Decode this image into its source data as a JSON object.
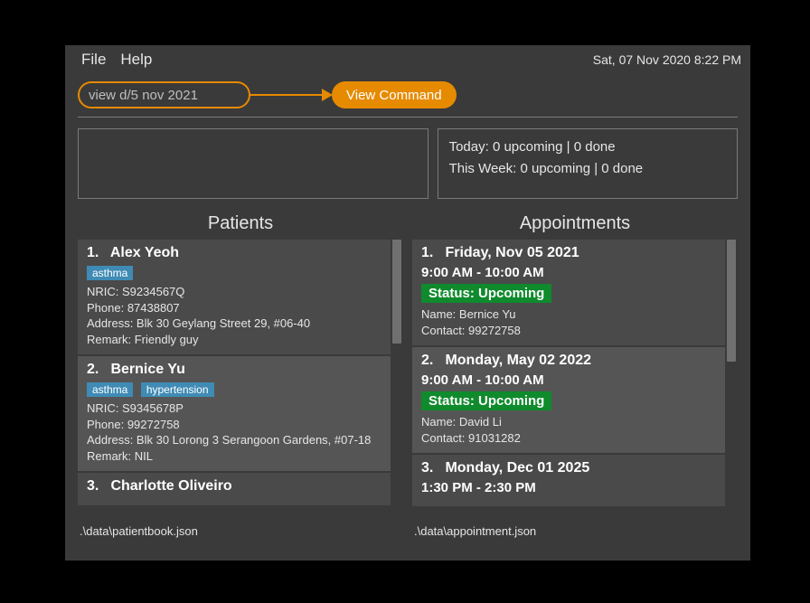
{
  "menu": {
    "file": "File",
    "help": "Help"
  },
  "datetime": "Sat, 07 Nov 2020 8:22 PM",
  "command": {
    "input_text": "view d/5 nov 2021",
    "button_label": "View Command"
  },
  "summary": {
    "today": "Today: 0 upcoming | 0 done",
    "week": "This Week: 0 upcoming | 0 done"
  },
  "patients": {
    "title": "Patients",
    "items": [
      {
        "idx": "1.",
        "name": "Alex Yeoh",
        "tags": [
          "asthma"
        ],
        "nric": "NRIC: S9234567Q",
        "phone": "Phone: 87438807",
        "address": "Address: Blk 30 Geylang Street 29, #06-40",
        "remark": "Remark: Friendly guy"
      },
      {
        "idx": "2.",
        "name": "Bernice Yu",
        "tags": [
          "asthma",
          "hypertension"
        ],
        "nric": "NRIC: S9345678P",
        "phone": "Phone: 99272758",
        "address": "Address: Blk 30 Lorong 3 Serangoon Gardens, #07-18",
        "remark": "Remark: NIL"
      },
      {
        "idx": "3.",
        "name": "Charlotte Oliveiro"
      }
    ]
  },
  "appointments": {
    "title": "Appointments",
    "items": [
      {
        "idx": "1.",
        "date": "Friday, Nov 05 2021",
        "time": "9:00 AM - 10:00 AM",
        "status": "Status: Upcoming",
        "name": "Name: Bernice Yu",
        "contact": "Contact: 99272758"
      },
      {
        "idx": "2.",
        "date": "Monday, May 02 2022",
        "time": "9:00 AM - 10:00 AM",
        "status": "Status: Upcoming",
        "name": "Name: David Li",
        "contact": "Contact: 91031282"
      },
      {
        "idx": "3.",
        "date": "Monday, Dec 01 2025",
        "time": "1:30 PM - 2:30 PM"
      }
    ]
  },
  "footer": {
    "patients_path": ".\\data\\patientbook.json",
    "appointments_path": ".\\data\\appointment.json"
  }
}
